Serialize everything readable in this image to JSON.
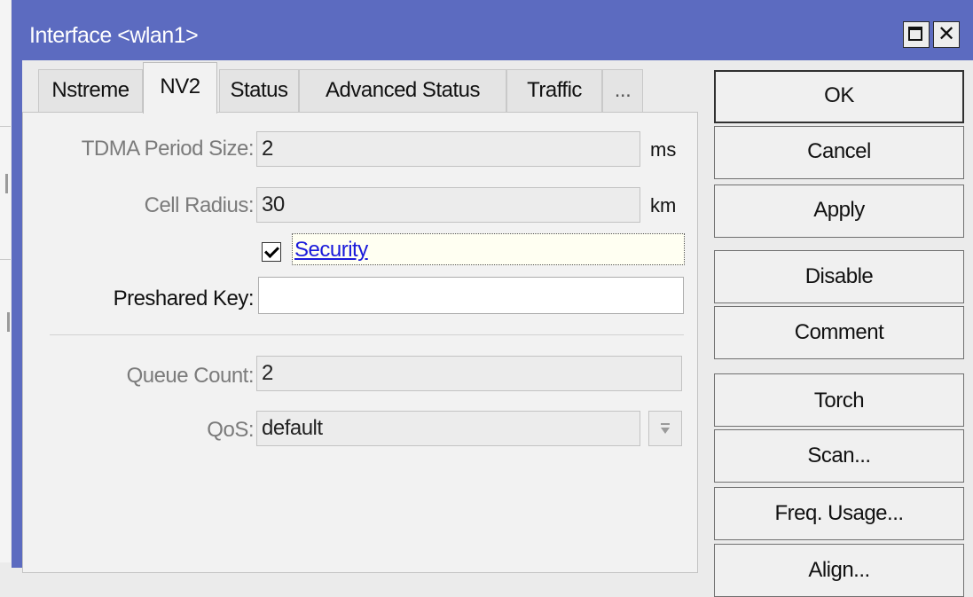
{
  "window": {
    "title": "Interface <wlan1>"
  },
  "tabs": [
    {
      "label": "Nstreme",
      "active": false
    },
    {
      "label": "NV2",
      "active": true
    },
    {
      "label": "Status",
      "active": false
    },
    {
      "label": "Advanced Status",
      "active": false
    },
    {
      "label": "Traffic",
      "active": false
    },
    {
      "label": "...",
      "active": false
    }
  ],
  "form": {
    "tdma_period_size": {
      "label": "TDMA Period Size:",
      "value": "2",
      "unit": "ms"
    },
    "cell_radius": {
      "label": "Cell Radius:",
      "value": "30",
      "unit": "km"
    },
    "security": {
      "label": "Security",
      "checked": true
    },
    "preshared_key": {
      "label": "Preshared Key:",
      "value": ""
    },
    "queue_count": {
      "label": "Queue Count:",
      "value": "2"
    },
    "qos": {
      "label": "QoS:",
      "value": "default"
    }
  },
  "buttons": {
    "ok": "OK",
    "cancel": "Cancel",
    "apply": "Apply",
    "disable": "Disable",
    "comment": "Comment",
    "torch": "Torch",
    "scan": "Scan...",
    "freq_usage": "Freq. Usage...",
    "align": "Align..."
  },
  "colors": {
    "titlebar": "#5c6bc0",
    "link_label": "#1a1adb"
  }
}
